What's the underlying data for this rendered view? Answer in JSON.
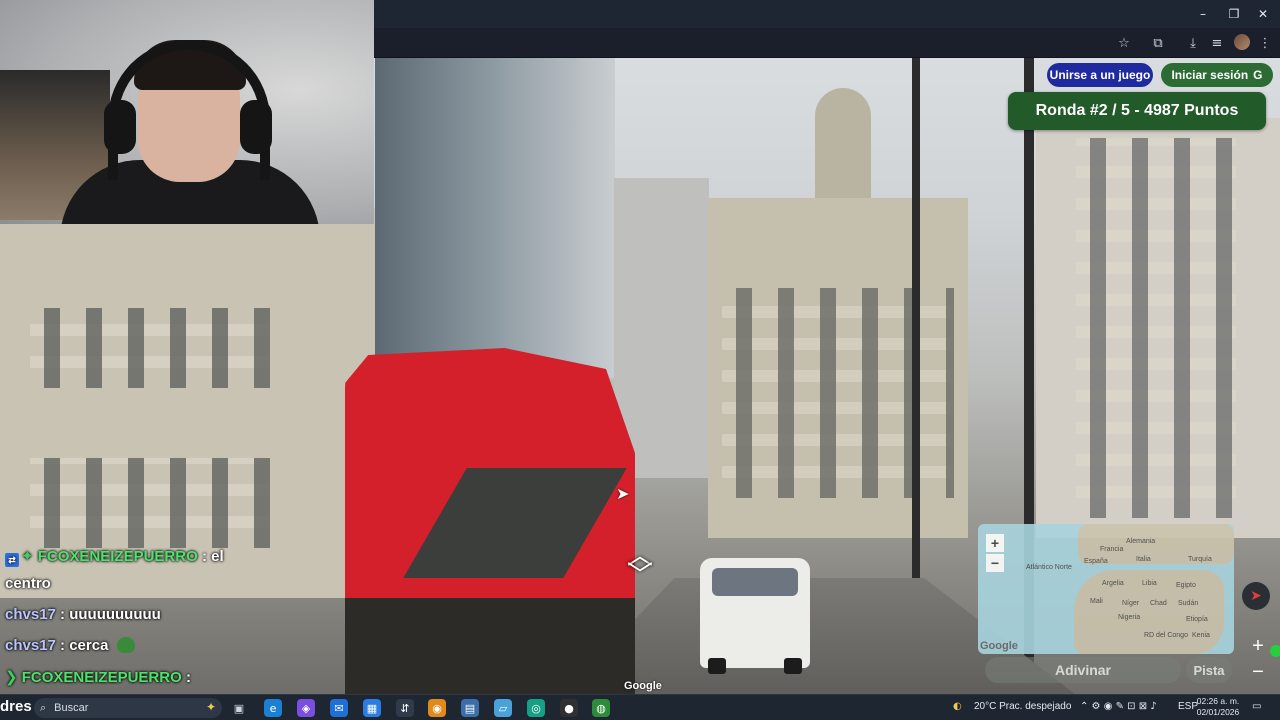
{
  "game": {
    "join_label": "Unirse a un juego",
    "login_label": "Iniciar sesión",
    "login_icon": "G",
    "round_text": "Ronda #2 / 5 - 4987 Puntos",
    "guess_label": "Adivinar",
    "hint_label": "Pista",
    "google_watermark": "Google",
    "minimap": {
      "zoom_in": "+",
      "zoom_out": "−",
      "google_logo": "Google",
      "labels": [
        "Atlántico Norte",
        "Alemania",
        "Francia",
        "España",
        "Italia",
        "Turquía",
        "Argelia",
        "Libia",
        "Egipto",
        "Mali",
        "Níger",
        "Chad",
        "Sudán",
        "Nigeria",
        "Etiopía",
        "Kenia",
        "RD del Congo"
      ]
    }
  },
  "chat": {
    "lines": [
      {
        "user": "FCOXENEIZEPUERRO",
        "text": ": el"
      },
      {
        "user": "",
        "text": "centro"
      },
      {
        "user": "chvs17",
        "text": ": uuuuuuuuuu"
      },
      {
        "user": "chvs17",
        "text": ": cerca"
      },
      {
        "user": "FCOXENEIZEPUERRO",
        "text": ":"
      }
    ]
  },
  "taskbar": {
    "left_text": "dres",
    "search_placeholder": "Buscar",
    "weather": "20°C  Prac. despejado",
    "language": "ESP",
    "time": "02:26 a. m.",
    "date": "02/01/2026"
  },
  "browser": {
    "window_controls": [
      "–",
      "❐",
      "✕"
    ]
  },
  "colors": {
    "join_button": "#1f2a9e",
    "login_button": "#2c6b33",
    "round_badge": "#235a2a",
    "chat_username": "#4be36a"
  }
}
